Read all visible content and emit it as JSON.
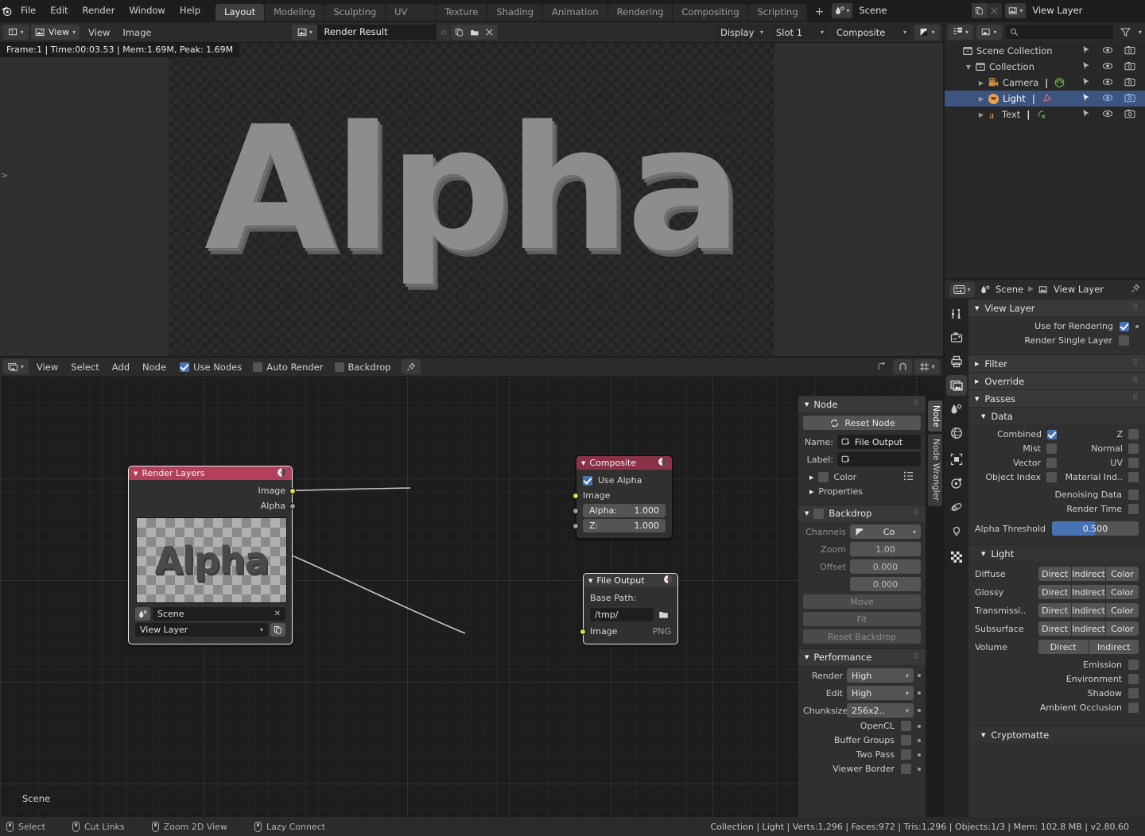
{
  "topbar": {
    "menus": [
      "File",
      "Edit",
      "Render",
      "Window",
      "Help"
    ],
    "workspace_tabs": [
      {
        "label": "Layout",
        "active": true
      },
      {
        "label": "Modeling",
        "active": false
      },
      {
        "label": "Sculpting",
        "active": false
      },
      {
        "label": "UV Editing",
        "active": false
      },
      {
        "label": "Texture Paint",
        "active": false
      },
      {
        "label": "Shading",
        "active": false
      },
      {
        "label": "Animation",
        "active": false
      },
      {
        "label": "Rendering",
        "active": false
      },
      {
        "label": "Compositing",
        "active": false
      },
      {
        "label": "Scripting",
        "active": false
      },
      {
        "label": "+",
        "active": false
      }
    ],
    "scene_name": "Scene",
    "view_layer_name": "View Layer"
  },
  "image_editor": {
    "menus": [
      "View",
      "Image"
    ],
    "view_popover": "View",
    "image_name": "Render Result",
    "display_label": "Display",
    "slot_label": "Slot 1",
    "pass_label": "Composite",
    "render_info": "Frame:1 | Time:00:03.53 | Mem:1.69M, Peak: 1.69M",
    "canvas_text": "Alpha"
  },
  "node_editor": {
    "menus": [
      "View",
      "Select",
      "Add",
      "Node"
    ],
    "toggles": [
      {
        "label": "Use Nodes",
        "checked": true
      },
      {
        "label": "Auto Render",
        "checked": false
      },
      {
        "label": "Backdrop",
        "checked": false
      }
    ],
    "nodes": {
      "render_layers": {
        "title": "Render Layers",
        "outputs": [
          "Image",
          "Alpha"
        ],
        "preview_text": "Alpha",
        "scene_value": "Scene",
        "layer_value": "View Layer"
      },
      "composite": {
        "title": "Composite",
        "use_alpha_label": "Use Alpha",
        "use_alpha_checked": true,
        "image_socket": "Image",
        "alpha_label": "Alpha:",
        "alpha_value": "1.000",
        "z_label": "Z:",
        "z_value": "1.000"
      },
      "file_output": {
        "title": "File Output",
        "base_path_label": "Base Path:",
        "base_path_value": "/tmp/",
        "image_socket": "Image",
        "format": "PNG"
      }
    }
  },
  "n_panel": {
    "tabs": [
      {
        "label": "Node",
        "active": true
      },
      {
        "label": "Node Wrangler",
        "active": false
      }
    ],
    "node_section": {
      "title": "Node",
      "reset_button": "Reset Node",
      "name_label": "Name:",
      "name_value": "File Output",
      "label_label": "Label:",
      "label_value": "",
      "color_label": "Color",
      "properties_label": "Properties"
    },
    "backdrop_section": {
      "title": "Backdrop",
      "checked": false,
      "channels_label": "Channels",
      "channels_value": "Co",
      "zoom_label": "Zoom",
      "zoom_value": "1.00",
      "offset_label": "Offset",
      "offset_x": "0.000",
      "offset_y": "0.000",
      "move_button": "Move",
      "fit_button": "Fit",
      "reset_button": "Reset Backdrop"
    },
    "performance_section": {
      "title": "Performance",
      "render_label": "Render",
      "render_value": "High",
      "edit_label": "Edit",
      "edit_value": "High",
      "chunksize_label": "Chunksize",
      "chunksize_value": "256x2..",
      "opencl_label": "OpenCL",
      "buffer_groups_label": "Buffer Groups",
      "two_pass_label": "Two Pass",
      "viewer_border_label": "Viewer Border"
    }
  },
  "outliner": {
    "rows": [
      {
        "name": "Scene Collection",
        "icon": "collection-icon",
        "indent": 0,
        "selected": false,
        "expander": "",
        "has_data": false
      },
      {
        "name": "Collection",
        "icon": "collection-icon",
        "indent": 1,
        "selected": false,
        "expander": "▼",
        "has_data": false
      },
      {
        "name": "Camera",
        "icon": "camera-icon",
        "indent": 2,
        "selected": false,
        "expander": "▶",
        "has_data": true
      },
      {
        "name": "Light",
        "icon": "light-icon",
        "indent": 2,
        "selected": true,
        "expander": "▶",
        "has_data": true
      },
      {
        "name": "Text",
        "icon": "text-icon",
        "indent": 2,
        "selected": false,
        "expander": "▶",
        "has_data": true
      }
    ]
  },
  "properties": {
    "breadcrumb_scene": "Scene",
    "breadcrumb_view_layer": "View Layer",
    "view_layer_section": {
      "title": "View Layer",
      "use_for_rendering_label": "Use for Rendering",
      "use_for_rendering_checked": true,
      "render_single_layer_label": "Render Single Layer",
      "render_single_layer_checked": false
    },
    "filter_label": "Filter",
    "override_label": "Override",
    "passes_label": "Passes",
    "data_section": {
      "title": "Data",
      "left": [
        {
          "label": "Combined",
          "checked": true
        },
        {
          "label": "Mist",
          "checked": false
        },
        {
          "label": "Vector",
          "checked": false
        },
        {
          "label": "Object Index",
          "checked": false
        }
      ],
      "right": [
        {
          "label": "Z",
          "checked": false
        },
        {
          "label": "Normal",
          "checked": false
        },
        {
          "label": "UV",
          "checked": false
        },
        {
          "label": "Material Ind..",
          "checked": false
        }
      ],
      "extra": [
        {
          "label": "Denoising Data",
          "checked": false
        },
        {
          "label": "Render Time",
          "checked": false
        }
      ],
      "alpha_threshold_label": "Alpha Threshold",
      "alpha_threshold_value": "0.500",
      "alpha_threshold_fraction": 0.5
    },
    "light_section": {
      "title": "Light",
      "rows": [
        {
          "label": "Diffuse",
          "buttons": [
            "Direct",
            "Indirect",
            "Color"
          ]
        },
        {
          "label": "Glossy",
          "buttons": [
            "Direct",
            "Indirect",
            "Color"
          ]
        },
        {
          "label": "Transmissi..",
          "buttons": [
            "Direct",
            "Indirect",
            "Color"
          ]
        },
        {
          "label": "Subsurface",
          "buttons": [
            "Direct",
            "Indirect",
            "Color"
          ]
        },
        {
          "label": "Volume",
          "buttons": [
            "Direct",
            "Indirect"
          ]
        }
      ],
      "checks": [
        {
          "label": "Emission",
          "checked": false
        },
        {
          "label": "Environment",
          "checked": false
        },
        {
          "label": "Shadow",
          "checked": false
        },
        {
          "label": "Ambient Occlusion",
          "checked": false
        }
      ]
    },
    "cryptomatte_label": "Cryptomatte"
  },
  "statusbar": {
    "items": [
      {
        "label": "Select",
        "icon": "mouse-left-icon"
      },
      {
        "label": "Cut Links",
        "icon": "mouse-right-icon"
      },
      {
        "label": "Zoom 2D View",
        "icon": "mouse-middle-icon"
      },
      {
        "label": "Lazy Connect",
        "icon": "mouse-left-icon"
      }
    ],
    "stats": "Collection | Light | Verts:1,296 | Faces:972 | Tris:1,296 | Objects:1/3 | Mem: 102.8 MB | v2.80.60"
  },
  "scene_tag": "Scene",
  "colors": {
    "accent_blue": "#4772b3",
    "node_red": "#b3405a",
    "selection": "#3b5580"
  }
}
